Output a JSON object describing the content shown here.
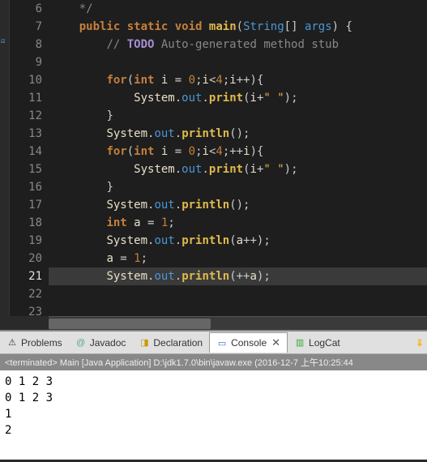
{
  "editor": {
    "lines": [
      6,
      7,
      8,
      9,
      10,
      11,
      12,
      13,
      14,
      15,
      16,
      17,
      18,
      19,
      20,
      21,
      22,
      23
    ],
    "current_line": 21,
    "marker_line": 8,
    "code": {
      "l6": {
        "indent": "    ",
        "tokens": [
          {
            "t": "comment",
            "v": "*/"
          }
        ]
      },
      "l7": {
        "indent": "    ",
        "tokens": [
          {
            "t": "kw",
            "v": "public"
          },
          {
            "t": "punct",
            "v": " "
          },
          {
            "t": "kw",
            "v": "static"
          },
          {
            "t": "punct",
            "v": " "
          },
          {
            "t": "kw",
            "v": "void"
          },
          {
            "t": "punct",
            "v": " "
          },
          {
            "t": "method",
            "v": "main"
          },
          {
            "t": "punct",
            "v": "("
          },
          {
            "t": "classname",
            "v": "String"
          },
          {
            "t": "punct",
            "v": "[] "
          },
          {
            "t": "param",
            "v": "args"
          },
          {
            "t": "punct",
            "v": ") {"
          }
        ]
      },
      "l8": {
        "indent": "        ",
        "tokens": [
          {
            "t": "comment",
            "v": "// "
          },
          {
            "t": "todo",
            "v": "TODO"
          },
          {
            "t": "comment",
            "v": " Auto-generated method stub"
          }
        ]
      },
      "l9": {
        "indent": "",
        "tokens": []
      },
      "l10": {
        "indent": "        ",
        "tokens": [
          {
            "t": "kw",
            "v": "for"
          },
          {
            "t": "punct",
            "v": "("
          },
          {
            "t": "kw",
            "v": "int"
          },
          {
            "t": "punct",
            "v": " "
          },
          {
            "t": "var",
            "v": "i"
          },
          {
            "t": "punct",
            "v": " = "
          },
          {
            "t": "num",
            "v": "0"
          },
          {
            "t": "punct",
            "v": ";"
          },
          {
            "t": "var",
            "v": "i"
          },
          {
            "t": "punct",
            "v": "<"
          },
          {
            "t": "num",
            "v": "4"
          },
          {
            "t": "punct",
            "v": ";"
          },
          {
            "t": "var",
            "v": "i"
          },
          {
            "t": "punct",
            "v": "++){"
          }
        ]
      },
      "l11": {
        "indent": "            ",
        "tokens": [
          {
            "t": "obj",
            "v": "System"
          },
          {
            "t": "punct",
            "v": "."
          },
          {
            "t": "field",
            "v": "out"
          },
          {
            "t": "punct",
            "v": "."
          },
          {
            "t": "method",
            "v": "print"
          },
          {
            "t": "punct",
            "v": "("
          },
          {
            "t": "var",
            "v": "i"
          },
          {
            "t": "punct",
            "v": "+"
          },
          {
            "t": "str",
            "v": "\" \""
          },
          {
            "t": "punct",
            "v": ");"
          }
        ]
      },
      "l12": {
        "indent": "        ",
        "tokens": [
          {
            "t": "punct",
            "v": "}"
          }
        ]
      },
      "l13": {
        "indent": "        ",
        "tokens": [
          {
            "t": "obj",
            "v": "System"
          },
          {
            "t": "punct",
            "v": "."
          },
          {
            "t": "field",
            "v": "out"
          },
          {
            "t": "punct",
            "v": "."
          },
          {
            "t": "method",
            "v": "println"
          },
          {
            "t": "punct",
            "v": "();"
          }
        ]
      },
      "l14": {
        "indent": "        ",
        "tokens": [
          {
            "t": "kw",
            "v": "for"
          },
          {
            "t": "punct",
            "v": "("
          },
          {
            "t": "kw",
            "v": "int"
          },
          {
            "t": "punct",
            "v": " "
          },
          {
            "t": "var",
            "v": "i"
          },
          {
            "t": "punct",
            "v": " = "
          },
          {
            "t": "num",
            "v": "0"
          },
          {
            "t": "punct",
            "v": ";"
          },
          {
            "t": "var",
            "v": "i"
          },
          {
            "t": "punct",
            "v": "<"
          },
          {
            "t": "num",
            "v": "4"
          },
          {
            "t": "punct",
            "v": ";++"
          },
          {
            "t": "var",
            "v": "i"
          },
          {
            "t": "punct",
            "v": "){"
          }
        ]
      },
      "l15": {
        "indent": "            ",
        "tokens": [
          {
            "t": "obj",
            "v": "System"
          },
          {
            "t": "punct",
            "v": "."
          },
          {
            "t": "field",
            "v": "out"
          },
          {
            "t": "punct",
            "v": "."
          },
          {
            "t": "method",
            "v": "print"
          },
          {
            "t": "punct",
            "v": "("
          },
          {
            "t": "var",
            "v": "i"
          },
          {
            "t": "punct",
            "v": "+"
          },
          {
            "t": "str",
            "v": "\" \""
          },
          {
            "t": "punct",
            "v": ");"
          }
        ]
      },
      "l16": {
        "indent": "        ",
        "tokens": [
          {
            "t": "punct",
            "v": "}"
          }
        ]
      },
      "l17": {
        "indent": "        ",
        "tokens": [
          {
            "t": "obj",
            "v": "System"
          },
          {
            "t": "punct",
            "v": "."
          },
          {
            "t": "field",
            "v": "out"
          },
          {
            "t": "punct",
            "v": "."
          },
          {
            "t": "method",
            "v": "println"
          },
          {
            "t": "punct",
            "v": "();"
          }
        ]
      },
      "l18": {
        "indent": "        ",
        "tokens": [
          {
            "t": "kw",
            "v": "int"
          },
          {
            "t": "punct",
            "v": " "
          },
          {
            "t": "var",
            "v": "a"
          },
          {
            "t": "punct",
            "v": " = "
          },
          {
            "t": "num",
            "v": "1"
          },
          {
            "t": "punct",
            "v": ";"
          }
        ]
      },
      "l19": {
        "indent": "        ",
        "tokens": [
          {
            "t": "obj",
            "v": "System"
          },
          {
            "t": "punct",
            "v": "."
          },
          {
            "t": "field",
            "v": "out"
          },
          {
            "t": "punct",
            "v": "."
          },
          {
            "t": "method",
            "v": "println"
          },
          {
            "t": "punct",
            "v": "("
          },
          {
            "t": "var",
            "v": "a"
          },
          {
            "t": "punct",
            "v": "++);"
          }
        ]
      },
      "l20": {
        "indent": "        ",
        "tokens": [
          {
            "t": "var",
            "v": "a"
          },
          {
            "t": "punct",
            "v": " = "
          },
          {
            "t": "num",
            "v": "1"
          },
          {
            "t": "punct",
            "v": ";"
          }
        ]
      },
      "l21": {
        "indent": "        ",
        "tokens": [
          {
            "t": "obj",
            "v": "System"
          },
          {
            "t": "punct",
            "v": "."
          },
          {
            "t": "field",
            "v": "out"
          },
          {
            "t": "punct",
            "v": "."
          },
          {
            "t": "method",
            "v": "println"
          },
          {
            "t": "punct",
            "v": "(++"
          },
          {
            "t": "var",
            "v": "a"
          },
          {
            "t": "punct",
            "v": ");"
          }
        ]
      },
      "l22": {
        "indent": "",
        "tokens": []
      },
      "l23": {
        "indent": "",
        "tokens": []
      }
    }
  },
  "tabs": {
    "problems": "Problems",
    "javadoc": "Javadoc",
    "declaration": "Declaration",
    "console": "Console",
    "logcat": "LogCat"
  },
  "status": "<terminated> Main [Java Application] D:\\jdk1.7.0\\bin\\javaw.exe (2016-12-7 上午10:25:44",
  "console_output": [
    "0 1 2 3 ",
    "0 1 2 3 ",
    "1",
    "2"
  ]
}
